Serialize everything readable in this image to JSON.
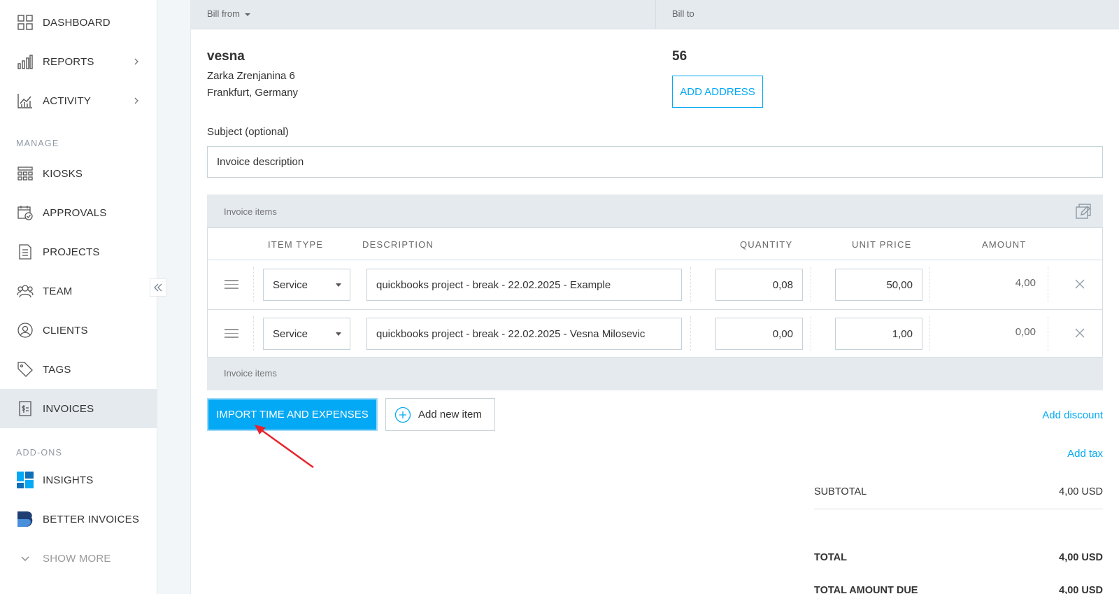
{
  "sidebar": {
    "items": [
      {
        "label": "DASHBOARD",
        "icon": "dashboard-icon"
      },
      {
        "label": "REPORTS",
        "icon": "reports-icon"
      },
      {
        "label": "ACTIVITY",
        "icon": "activity-icon"
      },
      {
        "label": "KIOSKS",
        "icon": "kiosks-icon"
      },
      {
        "label": "APPROVALS",
        "icon": "approvals-icon"
      },
      {
        "label": "PROJECTS",
        "icon": "projects-icon"
      },
      {
        "label": "TEAM",
        "icon": "team-icon"
      },
      {
        "label": "CLIENTS",
        "icon": "clients-icon"
      },
      {
        "label": "TAGS",
        "icon": "tags-icon"
      },
      {
        "label": "INVOICES",
        "icon": "invoices-icon",
        "active": true
      },
      {
        "label": "INSIGHTS",
        "icon": "insights-icon"
      },
      {
        "label": "BETTER INVOICES",
        "icon": "better-invoices-icon"
      }
    ],
    "sections": {
      "manage": "MANAGE",
      "addons": "ADD-ONS"
    },
    "show_more": "SHOW MORE"
  },
  "bill": {
    "from_label": "Bill from",
    "to_label": "Bill to",
    "from_name": "vesna",
    "from_address_line1": "Zarka Zrenjanina 6",
    "from_address_line2": "Frankfurt, Germany",
    "to_name": "56",
    "add_address_label": "ADD ADDRESS"
  },
  "subject": {
    "label": "Subject (optional)",
    "value": "Invoice description"
  },
  "items": {
    "header_label": "Invoice items",
    "footer_label": "Invoice items",
    "columns": {
      "item_type": "ITEM TYPE",
      "description": "DESCRIPTION",
      "quantity": "QUANTITY",
      "unit_price": "UNIT PRICE",
      "amount": "AMOUNT"
    },
    "rows": [
      {
        "type": "Service",
        "description": "quickbooks project - break - 22.02.2025 - Example",
        "quantity": "0,08",
        "unit_price": "50,00",
        "amount": "4,00"
      },
      {
        "type": "Service",
        "description": "quickbooks project - break - 22.02.2025 - Vesna Milosevic",
        "quantity": "0,00",
        "unit_price": "1,00",
        "amount": "0,00"
      }
    ]
  },
  "actions": {
    "import_label": "IMPORT TIME AND EXPENSES",
    "add_item_label": "Add new item",
    "add_discount": "Add discount",
    "add_tax": "Add tax"
  },
  "summary": {
    "subtotal_label": "SUBTOTAL",
    "subtotal_value": "4,00 USD",
    "total_label": "TOTAL",
    "total_value": "4,00 USD",
    "due_label": "TOTAL AMOUNT DUE",
    "due_value": "4,00 USD"
  },
  "colors": {
    "accent": "#03a9f4",
    "annotation_arrow": "#e8232d",
    "active_bg": "#e4eaee"
  }
}
